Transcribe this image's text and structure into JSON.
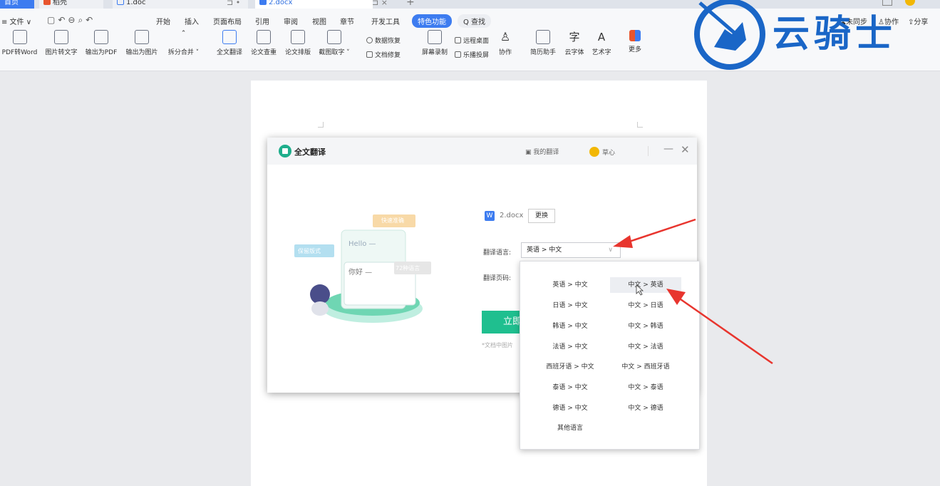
{
  "tabs": [
    {
      "label": "首页",
      "active": false
    },
    {
      "label": "稻壳",
      "active": false
    },
    {
      "label": "1.doc",
      "active": false
    },
    {
      "label": "2.docx",
      "active": true
    }
  ],
  "tab_controls": {
    "pin": "⊐ •",
    "close": "⊐ ×",
    "add": "+"
  },
  "menu": {
    "file": "≡ 文件 ∨",
    "items": [
      "开始",
      "插入",
      "页面布局",
      "引用",
      "审阅",
      "视图",
      "章节",
      "开发工具"
    ],
    "special": "特色功能",
    "search": "Q 查找",
    "sync": "未同步",
    "collab": "协作",
    "share": "分享"
  },
  "tools": [
    {
      "label": "PDF转Word"
    },
    {
      "label": "图片转文字"
    },
    {
      "label": "输出为PDF"
    },
    {
      "label": "输出为图片"
    },
    {
      "label": "拆分合并 ˅"
    },
    {
      "label": "全文翻译"
    },
    {
      "label": "论文查重"
    },
    {
      "label": "论文排版"
    },
    {
      "label": "截图取字 ˅"
    },
    {
      "label": "屏幕录制"
    },
    {
      "label": "协作"
    },
    {
      "label": "简历助手"
    },
    {
      "label": "云字体"
    },
    {
      "label": "艺术字"
    },
    {
      "label": "更多"
    }
  ],
  "tools_small": {
    "data_recovery": "数据恢复",
    "doc_repair": "文档修复",
    "remote_desktop": "远程桌面",
    "projection": "乐播投屏"
  },
  "logo": {
    "text": "云骑士"
  },
  "dialog": {
    "title": "全文翻译",
    "my_translations": "我的翻译",
    "user": "草心",
    "illustration": {
      "bubble_fast": "快速准确",
      "bubble_layout": "保留版式",
      "bubble_langs": "72种语言",
      "hello": "Hello —",
      "nihao": "你好 —"
    },
    "file_name": "2.docx",
    "change_btn": "更换",
    "lang_label": "翻译语言:",
    "page_label": "翻译页码:",
    "lang_value": "英语 > 中文",
    "start_btn": "立即",
    "note": "*文档中图片"
  },
  "dropdown": {
    "options": [
      [
        "英语 > 中文",
        "中文 > 英语"
      ],
      [
        "日语 > 中文",
        "中文 > 日语"
      ],
      [
        "韩语 > 中文",
        "中文 > 韩语"
      ],
      [
        "法语 > 中文",
        "中文 > 法语"
      ],
      [
        "西班牙语 > 中文",
        "中文 > 西班牙语"
      ],
      [
        "泰语 > 中文",
        "中文 > 泰语"
      ],
      [
        "德语 > 中文",
        "中文 > 德语"
      ]
    ],
    "other": "其他语言",
    "highlighted": "中文 > 英语"
  },
  "colors": {
    "accent": "#3d7cf0",
    "green": "#1fbf8f",
    "arrow": "#e8352e",
    "logo": "#1a66c7"
  }
}
